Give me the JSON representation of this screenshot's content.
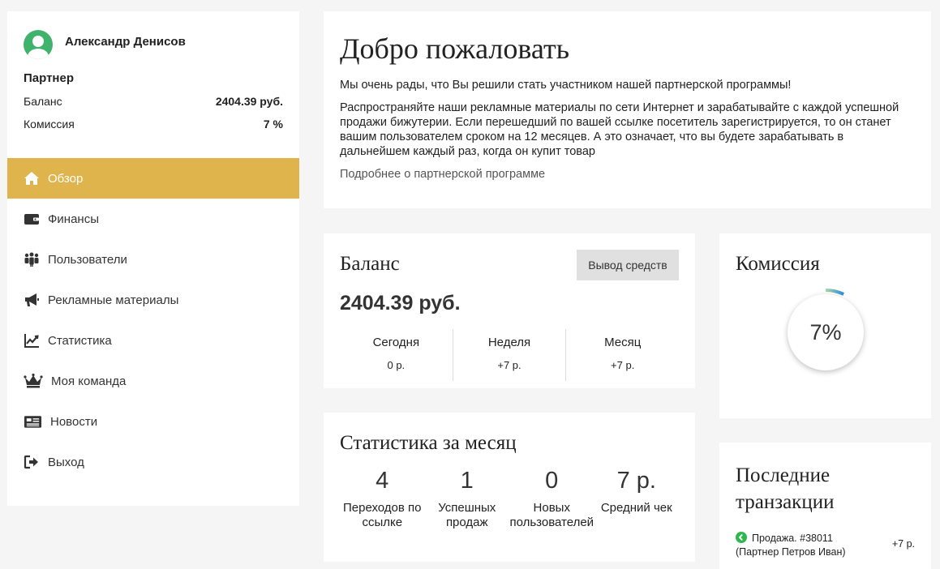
{
  "profile": {
    "name": "Александр Денисов",
    "role": "Партнер",
    "balance_label": "Баланс",
    "balance_value": "2404.39 руб.",
    "commission_label": "Комиссия",
    "commission_value": "7 %"
  },
  "nav": [
    {
      "label": "Обзор",
      "icon": "home-icon",
      "active": true
    },
    {
      "label": "Финансы",
      "icon": "wallet-icon"
    },
    {
      "label": "Пользователи",
      "icon": "users-icon"
    },
    {
      "label": "Рекламные материалы",
      "icon": "megaphone-icon"
    },
    {
      "label": "Статистика",
      "icon": "chart-icon"
    },
    {
      "label": "Моя команда",
      "icon": "crown-icon"
    },
    {
      "label": "Новости",
      "icon": "newspaper-icon"
    },
    {
      "label": "Выход",
      "icon": "logout-icon"
    }
  ],
  "welcome": {
    "title": "Добро пожаловать",
    "text1": "Мы очень рады, что Вы решили стать участником нашей партнерской программы!",
    "text2": "Распространяйте наши рекламные материалы по сети Интернет и зарабатывайте с каждой успешной продажи бижутерии. Если перешедший по вашей ссылке посетитель зарегистрируется, то он станет вашим пользователем сроком на 12 месяцев. А это означает, что вы будете зарабатывать в дальнейшем каждый раз, когда он купит товар",
    "link": "Подробнее о партнерской программе"
  },
  "balance": {
    "title": "Баланс",
    "withdraw_label": "Вывод средств",
    "amount": "2404.39 руб.",
    "periods": [
      {
        "label": "Сегодня",
        "value": "0 р."
      },
      {
        "label": "Неделя",
        "value": "+7 р."
      },
      {
        "label": "Месяц",
        "value": "+7 р."
      }
    ]
  },
  "stats": {
    "title": "Статистика за месяц",
    "items": [
      {
        "value": "4",
        "label": "Переходов по ссылке"
      },
      {
        "value": "1",
        "label": "Успешных продаж"
      },
      {
        "value": "0",
        "label": "Новых пользователей"
      },
      {
        "value": "7 р.",
        "label": "Средний чек"
      }
    ]
  },
  "commission": {
    "title": "Комиссия",
    "value_text": "7%",
    "percent": 7,
    "colors": {
      "arc_start": "#a8d8a0",
      "arc_end": "#2a8de0"
    }
  },
  "transactions": {
    "title": "Последние транзакции",
    "items": [
      {
        "desc": "Продажа. #38011",
        "sub": "(Партнер Петров Иван)",
        "amount": "+7 р.",
        "icon": "arrow-left-circle-icon"
      }
    ]
  },
  "colors": {
    "accent": "#e0b44c",
    "avatar": "#3fb36b",
    "success": "#2db84d"
  }
}
